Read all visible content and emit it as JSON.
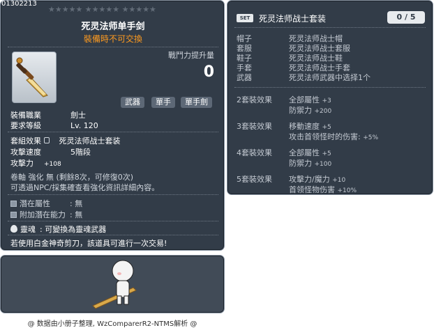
{
  "item_code": "01302213",
  "stars": "★★★★★ ★★★★★ ★★★★★",
  "item_name": "死灵法师单手剑",
  "trade_status": "裝備時不可交換",
  "power_increase_label": "戰鬥力提升量",
  "power_increase_value": "0",
  "tags": [
    "武器",
    "單手",
    "單手劍"
  ],
  "job": {
    "label": "裝備職業",
    "value": "劍士"
  },
  "req_level": {
    "label": "要求等級",
    "value": "Lv. 120"
  },
  "set_effect": {
    "label": "套組效果",
    "value": "死灵法师战士套装"
  },
  "attack_speed": {
    "label": "攻擊速度",
    "value": "5階段"
  },
  "attack": {
    "label": "攻擊力",
    "value": "+108"
  },
  "scroll_line": "卷軸 強化 無 (剩餘8次，可修復0次)",
  "npc_line": "可透過NPC/採集確查看強化資訊詳細內容。",
  "potential": {
    "label": "潛在屬性",
    "value": ": 無"
  },
  "extra_potential": {
    "label": "附加潛在能力",
    "value": ": 無"
  },
  "soul": {
    "label": "靈魂",
    "value": ": 可變換為靈魂武器"
  },
  "scissors_note": "若使用白金神奇剪刀，該道具可進行一次交易!",
  "set_panel": {
    "badge": "SET",
    "title": "死灵法师战士套装",
    "count": "0 / 5",
    "parts": [
      {
        "slot": "帽子",
        "name": "死灵法师战士帽"
      },
      {
        "slot": "套服",
        "name": "死灵法师战士套服"
      },
      {
        "slot": "鞋子",
        "name": "死灵法师战士鞋"
      },
      {
        "slot": "手套",
        "name": "死灵法师战士手套"
      },
      {
        "slot": "武器",
        "name": "死灵法师武器中选择1个"
      }
    ],
    "effects": [
      {
        "label": "2套裝效果",
        "lines": [
          [
            "全部屬性",
            "+3"
          ],
          [
            "防禦力",
            "+200"
          ]
        ]
      },
      {
        "label": "3套裝效果",
        "lines": [
          [
            "移動速度",
            "+5"
          ],
          [
            "攻击首领怪时的伤害:",
            "+5%"
          ]
        ]
      },
      {
        "label": "4套裝效果",
        "lines": [
          [
            "全部屬性",
            "+5"
          ],
          [
            "防禦力",
            "+100"
          ]
        ]
      },
      {
        "label": "5套裝效果",
        "lines": [
          [
            "攻擊力/魔力",
            "+10"
          ],
          [
            "首领怪物伤害",
            "+10%"
          ]
        ]
      }
    ]
  },
  "footer": "@ 数据由小册子整理, WzComparerR2-NTMS解析 @",
  "colors": {
    "panel_bg": "#323c48",
    "trade_orange": "#ff9b1f",
    "border": "#8b97a6"
  },
  "icons": [
    "sword-icon",
    "lock-icon",
    "soul-flame-icon",
    "character-avatar"
  ]
}
